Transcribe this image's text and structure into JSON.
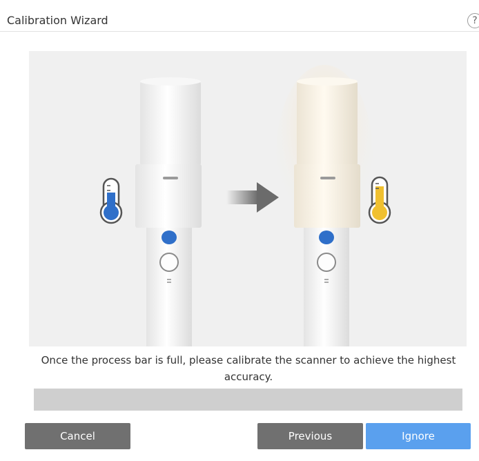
{
  "dialog": {
    "title": "Calibration Wizard",
    "help_label": "?"
  },
  "illustration": {
    "left_scanner_state": "cold",
    "right_scanner_state": "warm",
    "left_thermometer_color": "#2f6fc9",
    "right_thermometer_color": "#f0c030",
    "arrow_icon": "arrow-right-icon"
  },
  "message": {
    "text": "Once the process bar is full, please calibrate the scanner to achieve the highest accuracy."
  },
  "progress": {
    "value": 0
  },
  "buttons": {
    "cancel_label": "Cancel",
    "previous_label": "Previous",
    "ignore_label": "Ignore"
  },
  "colors": {
    "primary_button": "#5aa0ee",
    "secondary_button": "#707070",
    "progress_track": "#cfcfcf"
  }
}
